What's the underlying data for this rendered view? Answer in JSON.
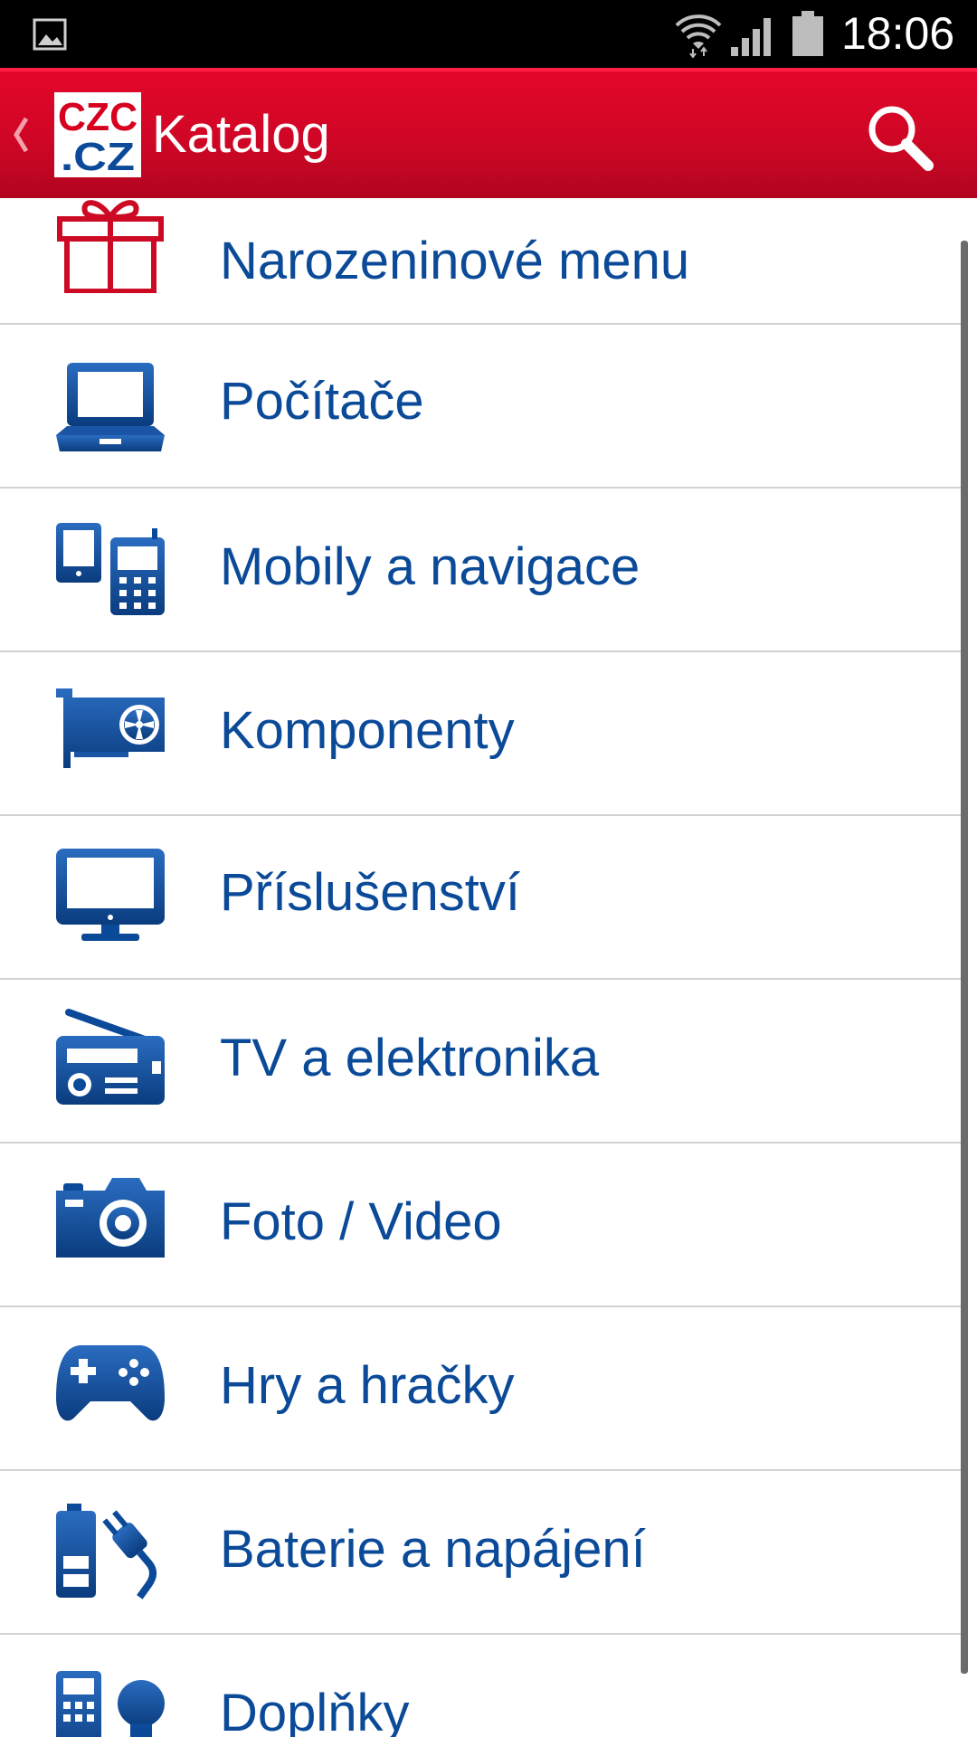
{
  "status_bar": {
    "time": "18:06",
    "icons": [
      "image-notification-icon",
      "wifi-icon",
      "signal-icon",
      "battery-icon"
    ]
  },
  "app_bar": {
    "title": "Katalog",
    "logo_text": "CZC.CZ",
    "logo_line1": "CZC",
    "logo_line2": ".CZ",
    "back_icon": "chevron-left-icon",
    "search_icon": "search-icon",
    "colors": {
      "bar": "#d0061f",
      "logo_red": "#d7001f",
      "logo_blue": "#0b4a98"
    }
  },
  "catalog": {
    "text_color": "#0b4a98",
    "items": [
      {
        "label": "Narozeninové menu",
        "icon": "gift-icon"
      },
      {
        "label": "Počítače",
        "icon": "laptop-icon"
      },
      {
        "label": "Mobily a navigace",
        "icon": "mobile-phones-icon"
      },
      {
        "label": "Komponenty",
        "icon": "graphics-card-icon"
      },
      {
        "label": "Příslušenství",
        "icon": "monitor-icon"
      },
      {
        "label": "TV a elektronika",
        "icon": "radio-icon"
      },
      {
        "label": "Foto / Video",
        "icon": "camera-icon"
      },
      {
        "label": "Hry a hračky",
        "icon": "gamepad-icon"
      },
      {
        "label": "Baterie a napájení",
        "icon": "battery-plug-icon"
      },
      {
        "label": "Doplňky",
        "icon": "calculator-bulb-icon"
      }
    ]
  }
}
